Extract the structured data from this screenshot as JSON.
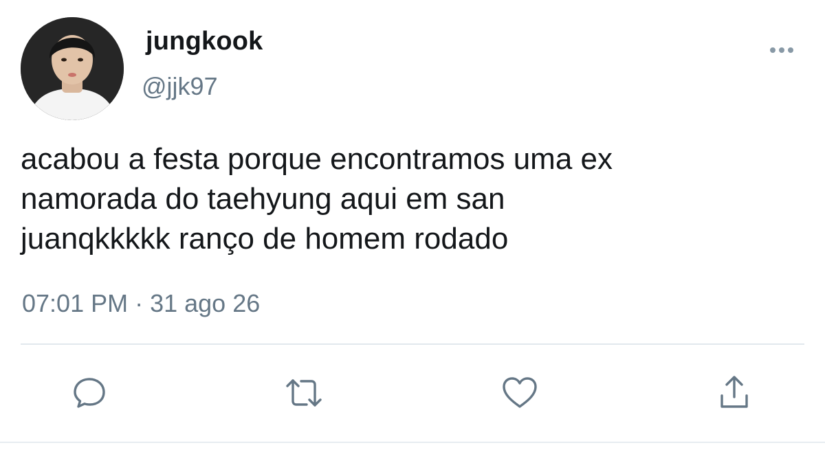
{
  "user": {
    "display_name": "jungkook",
    "handle": "@jjk97"
  },
  "tweet": {
    "lines": [
      "acabou a festa porque encontramos uma ex",
      "namorada do taehyung aqui em san",
      "juanqkkkkk ranço de homem rodado"
    ],
    "timestamp": "07:01 PM · 31 ago 26"
  },
  "icons": {
    "more": "more-dots-icon",
    "reply": "reply-bubble-icon",
    "retweet": "retweet-icon",
    "like": "heart-icon",
    "share": "share-icon"
  },
  "colors": {
    "text": "#14171a",
    "secondary": "#657786",
    "icon": "#657786",
    "divider": "#e1e8ed"
  }
}
